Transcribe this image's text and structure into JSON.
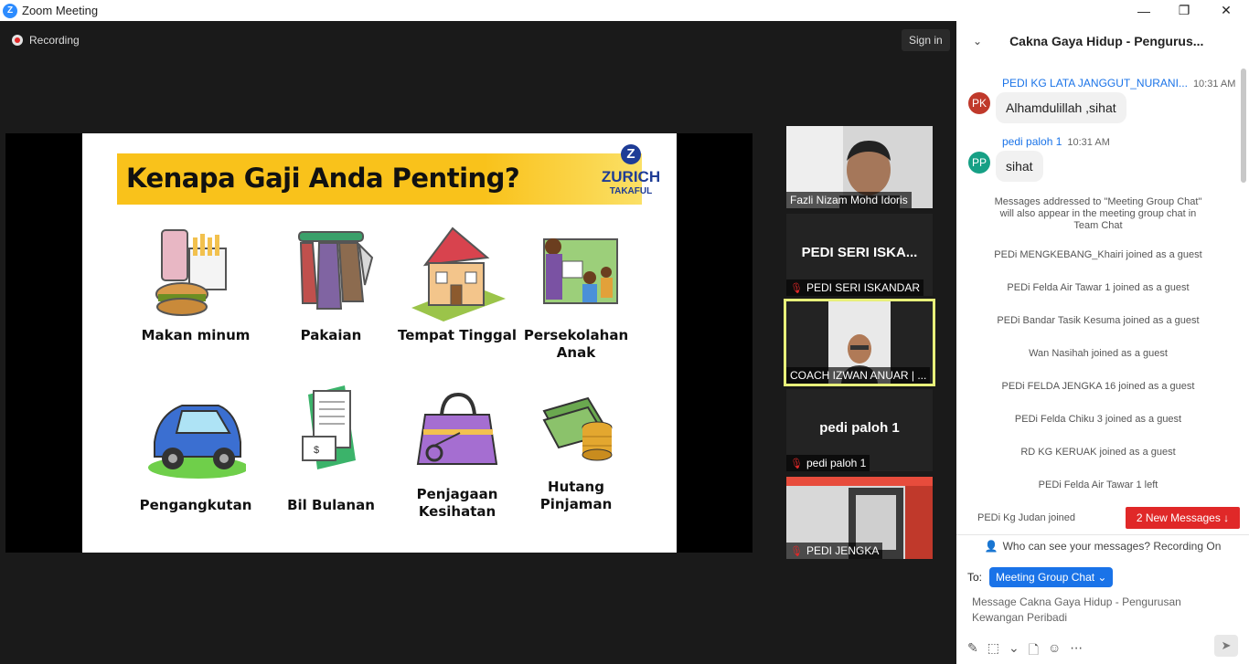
{
  "window": {
    "title": "Zoom Meeting",
    "minimize": "—",
    "maximize": "❐",
    "close": "✕"
  },
  "meeting": {
    "recording_label": "Recording",
    "signin_label": "Sign in"
  },
  "slide": {
    "title": "Kenapa Gaji Anda Penting?",
    "brand": "ZURICH",
    "brand_sub": "TAKAFUL",
    "brand_mark": "Z",
    "items": [
      {
        "label": "Makan minum"
      },
      {
        "label": "Pakaian"
      },
      {
        "label": "Tempat Tinggal"
      },
      {
        "label": "Persekolahan Anak"
      },
      {
        "label": "Pengangkutan"
      },
      {
        "label": "Bil Bulanan"
      },
      {
        "label": "Penjagaan Kesihatan"
      },
      {
        "label": "Hutang Pinjaman"
      }
    ]
  },
  "participants": [
    {
      "name": "Fazli Nizam Mohd Idoris",
      "video": true,
      "muted": false
    },
    {
      "name": "PEDI SERI ISKANDAR",
      "display": "PEDI SERI ISKA...",
      "video": false,
      "muted": true
    },
    {
      "name": "COACH IZWAN ANUAR | ...",
      "video": true,
      "muted": false,
      "active_speaker": true
    },
    {
      "name": "pedi paloh 1",
      "display": "pedi paloh 1",
      "video": false,
      "muted": true
    },
    {
      "name": "PEDI JENGKA",
      "video": true,
      "muted": true
    }
  ],
  "chat": {
    "title": "Cakna Gaya Hidup - Pengurus...",
    "messages": [
      {
        "initials": "PK",
        "avatar_color": "#c0392b",
        "sender": "PEDI KG LATA JANGGUT_NURANI...",
        "time": "10:31 AM",
        "text": "Alhamdulillah ,sihat"
      },
      {
        "initials": "PP",
        "avatar_color": "#16a085",
        "sender": "pedi paloh 1",
        "time": "10:31 AM",
        "text": "sihat"
      }
    ],
    "system_notice": "Messages addressed to \"Meeting Group Chat\" will also appear in the meeting group chat in Team Chat",
    "events": [
      "PEDi MENGKEBANG_Khairi joined as a guest",
      "PEDi Felda Air Tawar 1 joined as a guest",
      "PEDi Bandar Tasik Kesuma joined as a guest",
      "Wan Nasihah joined as a guest",
      "PEDi FELDA JENGKA 16 joined as a guest",
      "PEDi Felda Chiku 3 joined as a guest",
      "RD KG KERUAK joined as a guest",
      "PEDi Felda Air Tawar 1 left",
      "PEDi Kg Judan joined"
    ],
    "new_messages_label": "2 New Messages ↓",
    "who_can_see": "Who can see your messages? Recording On",
    "to_label": "To:",
    "to_target": "Meeting Group Chat ⌄",
    "input_placeholder": "Message Cakna Gaya Hidup - Pengurusan Kewangan Peribadi"
  }
}
